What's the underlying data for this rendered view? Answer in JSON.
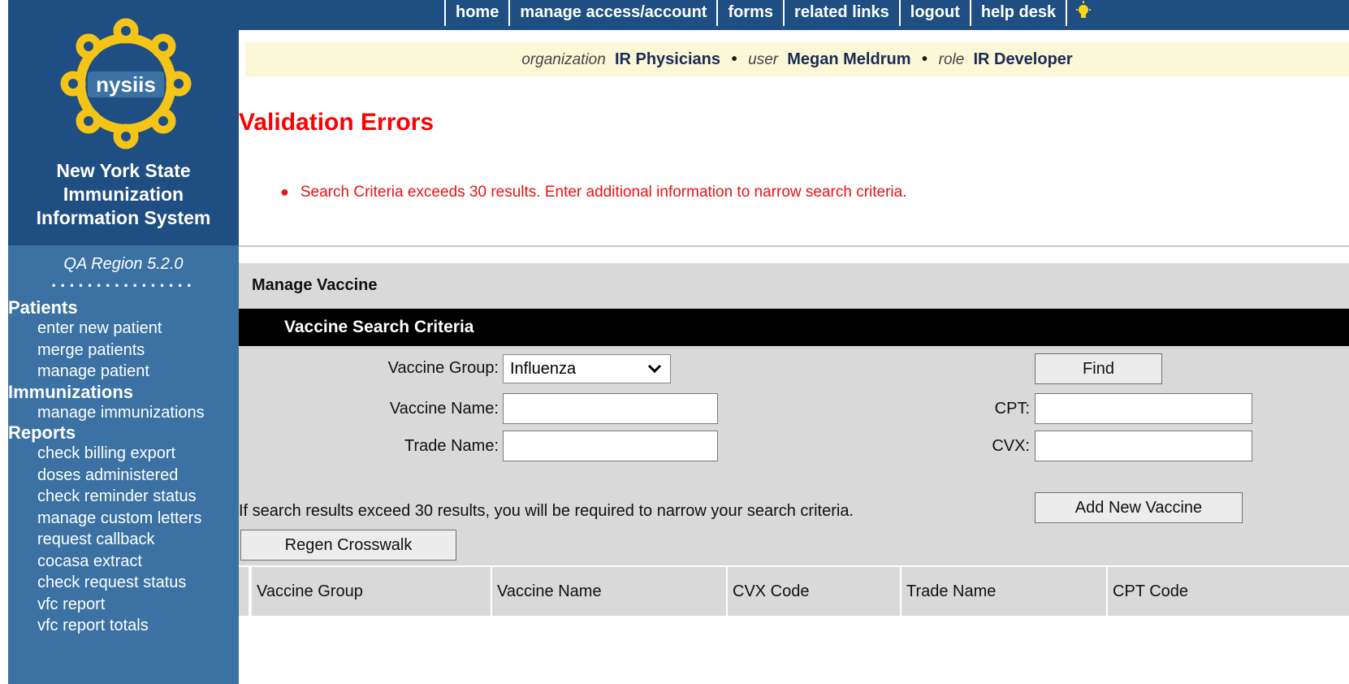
{
  "header": {
    "nav": [
      "home",
      "manage access/account",
      "forms",
      "related links",
      "logout",
      "help desk"
    ],
    "bulb_icon": "lightbulb-icon"
  },
  "userbar": {
    "org_label": "organization",
    "org_value": "IR Physicians",
    "user_label": "user",
    "user_value": "Megan Meldrum",
    "role_label": "role",
    "role_value": "IR Developer",
    "separator": "•"
  },
  "sidebar": {
    "logo_text": "nysiis",
    "system_name": [
      "New York State",
      "Immunization",
      "Information System"
    ],
    "region": "QA Region 5.2.0",
    "dots": "................",
    "sections": [
      {
        "heading": "Patients",
        "links": [
          "enter new patient",
          "merge patients",
          "manage patient"
        ]
      },
      {
        "heading": "Immunizations",
        "links": [
          "manage immunizations"
        ]
      },
      {
        "heading": "Reports",
        "links": [
          "check billing export",
          "doses administered",
          "check reminder status",
          "manage custom letters",
          "request callback",
          "cocasa extract",
          "check request status",
          "vfc report",
          "vfc report totals"
        ]
      }
    ]
  },
  "errors": {
    "title": "Validation Errors",
    "items": [
      "Search Criteria exceeds 30 results. Enter additional information to narrow search criteria."
    ]
  },
  "panel": {
    "title": "Manage Vaccine",
    "criteria_title": "Vaccine Search Criteria",
    "vaccine_group_label": "Vaccine Group:",
    "vaccine_group_value": "Influenza",
    "vaccine_name_label": "Vaccine Name:",
    "trade_name_label": "Trade Name:",
    "cpt_label": "CPT:",
    "cvx_label": "CVX:",
    "find_button": "Find",
    "add_button": "Add New Vaccine",
    "regen_button": "Regen Crosswalk",
    "note": "If search results exceed 30 results, you will be required to narrow your search criteria."
  },
  "results_table": {
    "columns": [
      "Vaccine Group",
      "Vaccine Name",
      "CVX Code",
      "Trade Name",
      "CPT Code"
    ]
  },
  "colors": {
    "sidebar_dark": "#1f4f82",
    "sidebar_light": "#3b72a3",
    "error_red": "#ff0000",
    "userbar_bg": "#fbf8d7",
    "panel_bg": "#d9d9d9"
  }
}
